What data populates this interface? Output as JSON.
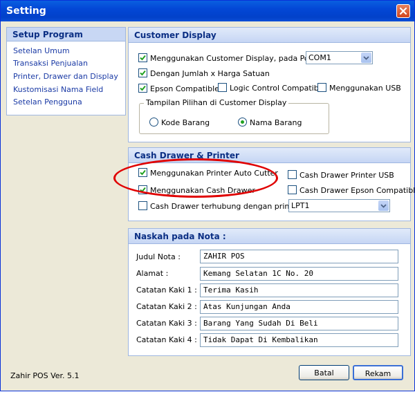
{
  "window": {
    "title": "Setting"
  },
  "sidebar": {
    "header": "Setup Program",
    "items": [
      {
        "label": "Setelan Umum"
      },
      {
        "label": "Transaksi Penjualan"
      },
      {
        "label": "Printer, Drawer dan Display"
      },
      {
        "label": "Kustomisasi Nama Field"
      },
      {
        "label": "Setelan Pengguna"
      }
    ]
  },
  "customer_display": {
    "header": "Customer Display",
    "use_display": {
      "label": "Menggunakan Customer Display, pada Port",
      "checked": true
    },
    "port": {
      "value": "COM1"
    },
    "qty_price": {
      "label": "Dengan Jumlah x Harga Satuan",
      "checked": true
    },
    "epson": {
      "label": "Epson Compatible",
      "checked": true
    },
    "logic_control": {
      "label": "Logic Control Compatible",
      "checked": false
    },
    "usb": {
      "label": "Menggunakan USB",
      "checked": false
    },
    "group_title": "Tampilan Pilihan di Customer Display",
    "radio_kode": {
      "label": "Kode Barang",
      "selected": false
    },
    "radio_nama": {
      "label": "Nama Barang",
      "selected": true
    }
  },
  "cash_drawer": {
    "header": "Cash Drawer & Printer",
    "auto_cutter": {
      "label": "Menggunakan Printer Auto Cutter",
      "checked": true
    },
    "use_drawer": {
      "label": "Menggunakan Cash Drawer",
      "checked": true
    },
    "drawer_usb": {
      "label": "Cash Drawer Printer USB",
      "checked": false
    },
    "drawer_epson": {
      "label": "Cash Drawer Epson Compatible",
      "checked": false
    },
    "drawer_printer": {
      "label": "Cash Drawer terhubung dengan printer",
      "checked": false
    },
    "printer_port": {
      "value": "LPT1"
    }
  },
  "naskah": {
    "header": "Naskah pada Nota :",
    "fields": [
      {
        "label": "Judul Nota :",
        "value": "ZAHIR POS"
      },
      {
        "label": "Alamat :",
        "value": "Kemang Selatan 1C No. 20"
      },
      {
        "label": "Catatan Kaki 1 :",
        "value": "Terima Kasih"
      },
      {
        "label": "Catatan Kaki 2 :",
        "value": "Atas Kunjungan Anda"
      },
      {
        "label": "Catatan Kaki 3 :",
        "value": "Barang Yang Sudah Di Beli"
      },
      {
        "label": "Catatan Kaki 4 :",
        "value": "Tidak Dapat Di Kembalikan"
      }
    ]
  },
  "footer": {
    "version": "Zahir POS Ver. 5.1",
    "cancel_label": "Batal",
    "save_label": "Rekam"
  },
  "colors": {
    "annotation": "#e00000",
    "titlebar": "#0347d6",
    "check": "#21a121"
  }
}
